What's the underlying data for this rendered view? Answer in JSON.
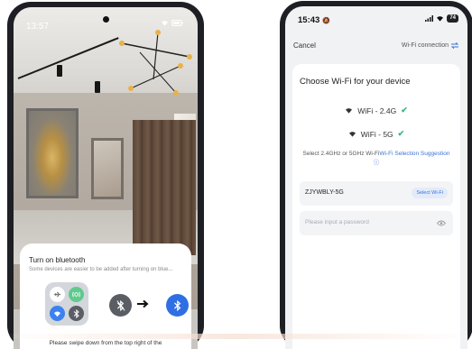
{
  "left_phone": {
    "status_time": "13:57",
    "bluetooth_sheet": {
      "title": "Turn on bluetooth",
      "subtitle": "Some devices are easier to be added after turning on blue...",
      "instruction": "Please swipe down from the top right of the"
    }
  },
  "right_phone": {
    "status_time": "15:43",
    "battery_badge": "74",
    "nav": {
      "cancel_label": "Cancel",
      "wifi_connection_label": "Wi-Fi connection"
    },
    "card": {
      "title": "Choose Wi-Fi for your device",
      "bands": [
        {
          "label": "WiFi - 2.4G",
          "supported": true
        },
        {
          "label": "WiFi - 5G",
          "supported": true
        }
      ],
      "hint_text": "Select 2.4GHz or 5GHz Wi-Fi",
      "hint_link": "Wi-Fi Selection Suggestion",
      "ssid_value": "ZJYWBLY-5G",
      "select_wifi_label": "Select Wi-Fi",
      "password_placeholder": "Please input a password"
    }
  },
  "colors": {
    "accent_blue": "#3b73d6",
    "check_green": "#39b982",
    "bluetooth_blue": "#2f6fe3",
    "bluetooth_off_gray": "#5a5d63"
  }
}
